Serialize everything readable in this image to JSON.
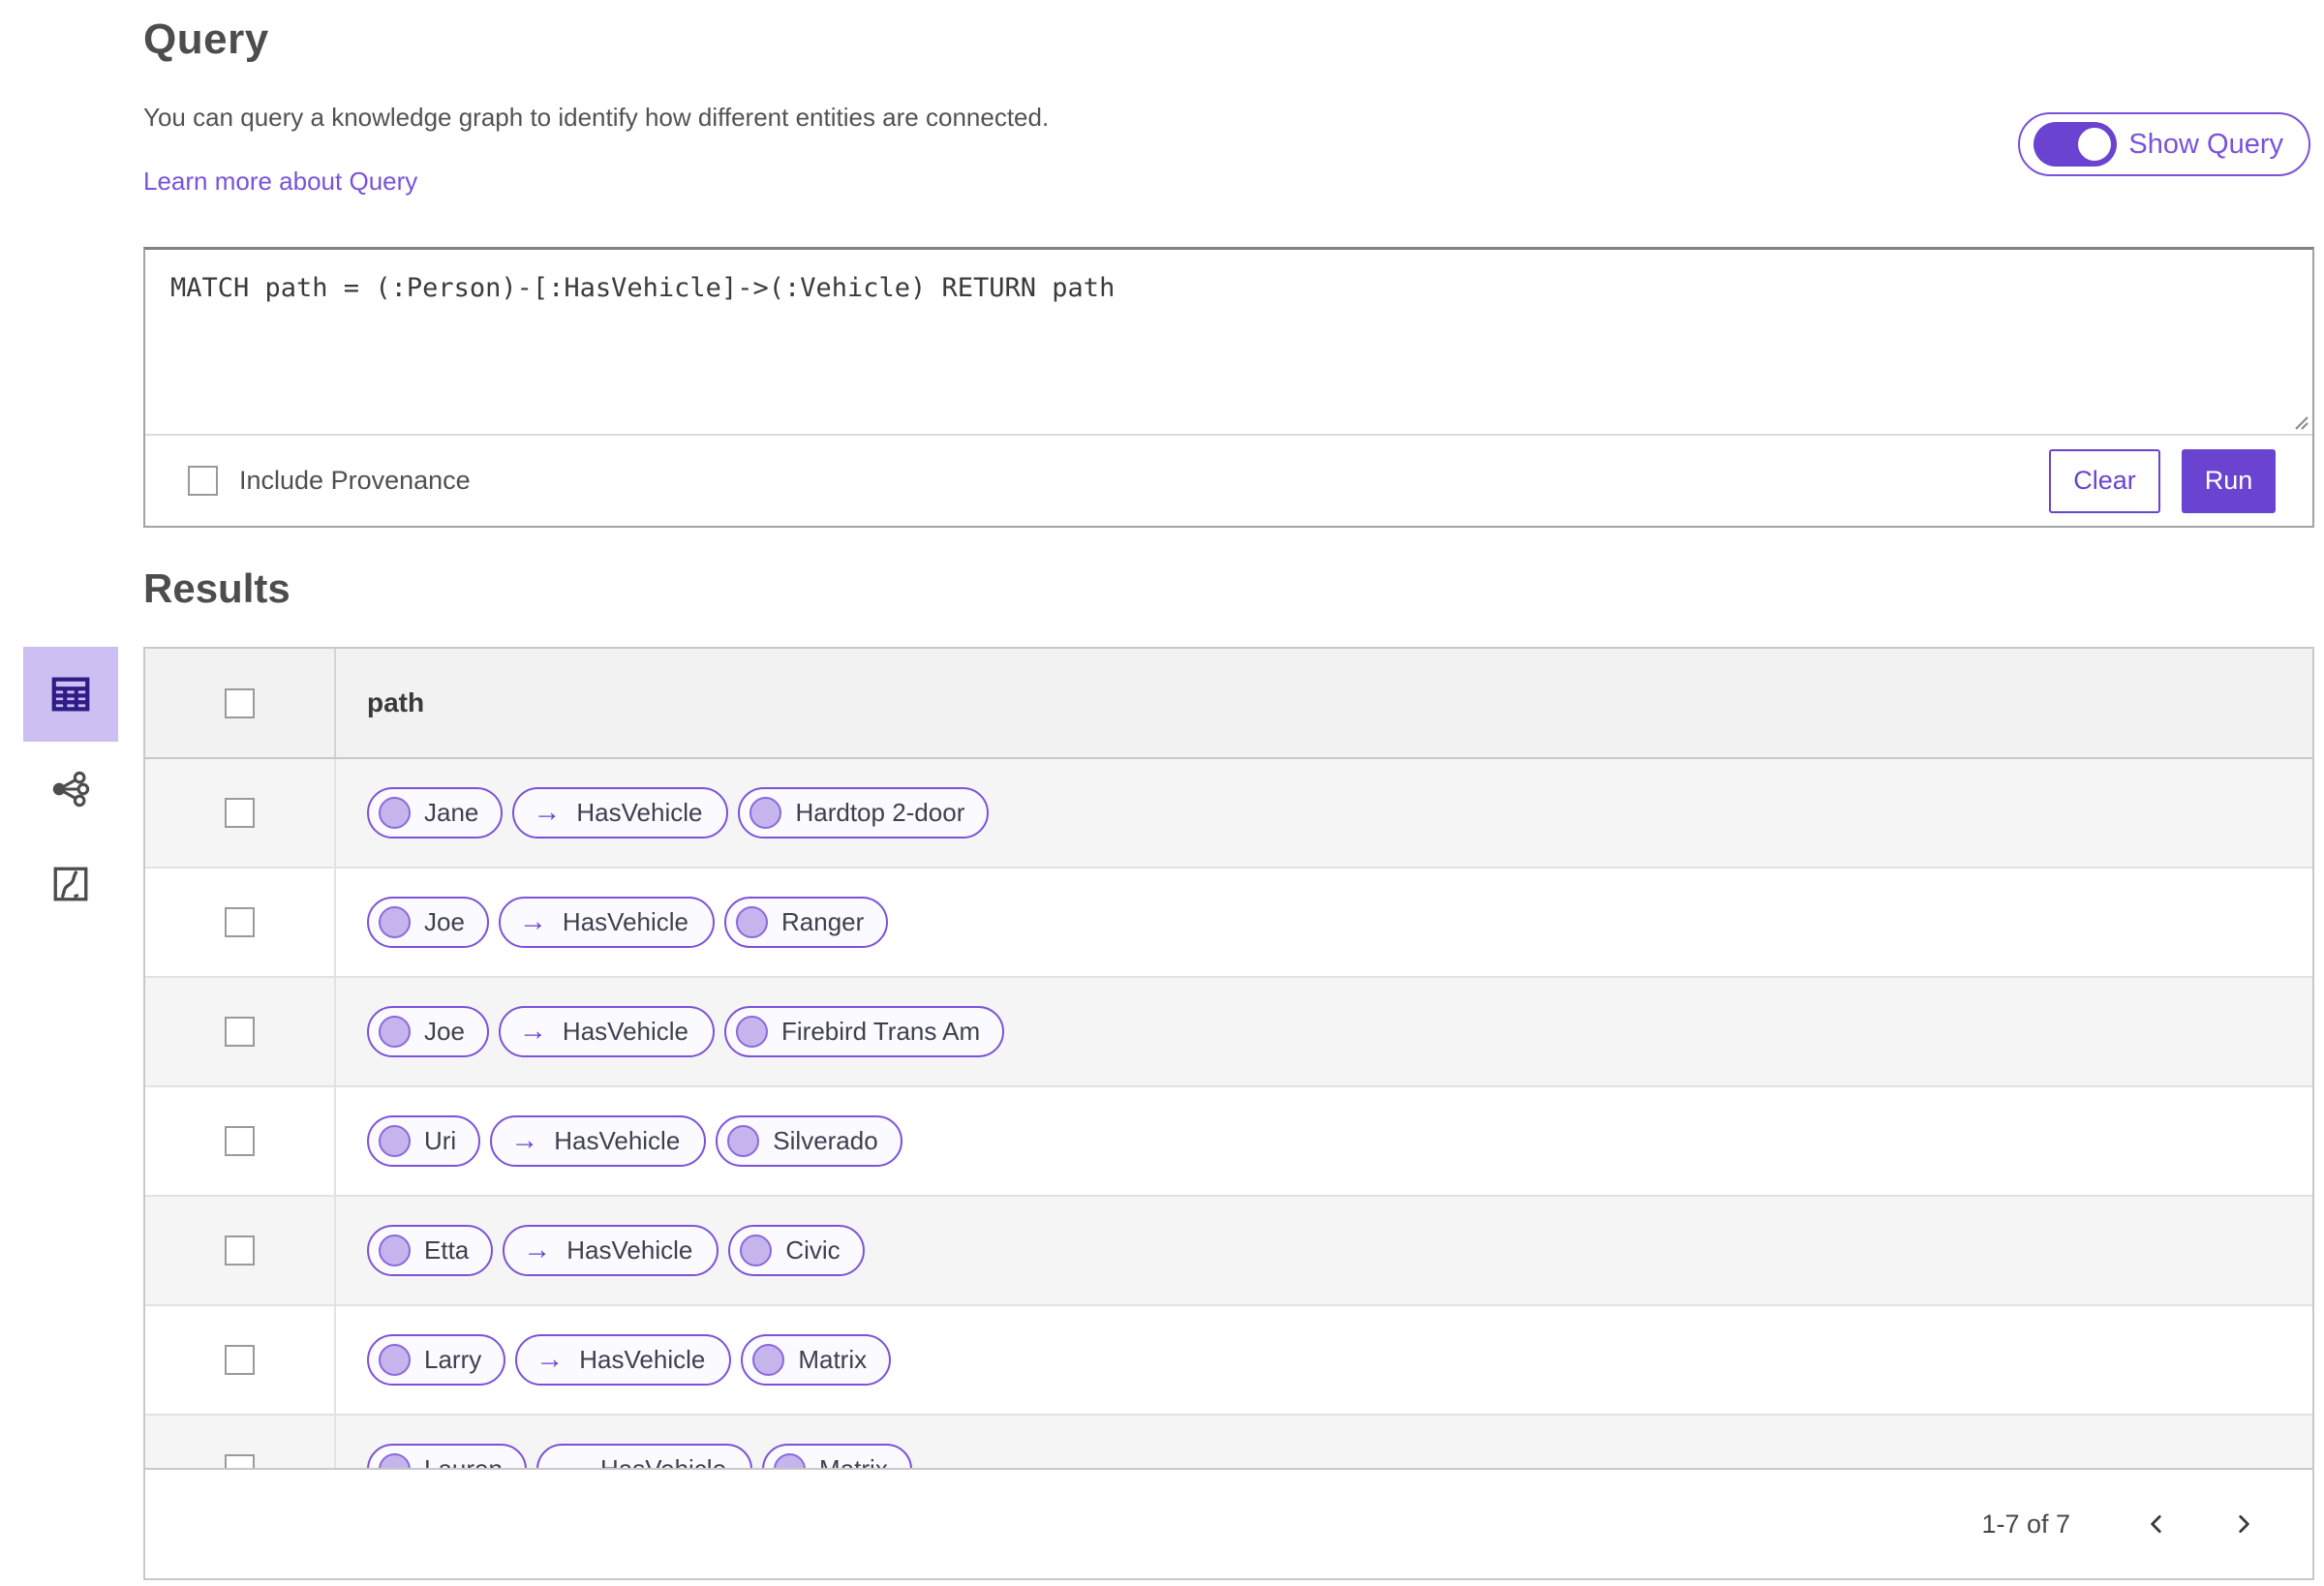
{
  "header": {
    "title": "Query",
    "description": "You can query a knowledge graph to identify how different entities are connected.",
    "learn_more_label": "Learn more about Query",
    "show_query_label": "Show Query",
    "show_query_on": true
  },
  "query": {
    "text": "MATCH path = (:Person)-[:HasVehicle]->(:Vehicle) RETURN path",
    "include_provenance_label": "Include Provenance",
    "include_provenance_checked": false,
    "clear_label": "Clear",
    "run_label": "Run"
  },
  "results": {
    "title": "Results",
    "column_header": "path",
    "edge_arrow": "→",
    "views": [
      {
        "icon": "table-grid-icon",
        "selected": true
      },
      {
        "icon": "network-graph-icon",
        "selected": false
      },
      {
        "icon": "map-route-icon",
        "selected": false
      }
    ],
    "rows": [
      {
        "source": "Jane",
        "relation": "HasVehicle",
        "target": "Hardtop 2-door"
      },
      {
        "source": "Joe",
        "relation": "HasVehicle",
        "target": "Ranger"
      },
      {
        "source": "Joe",
        "relation": "HasVehicle",
        "target": "Firebird Trans Am"
      },
      {
        "source": "Uri",
        "relation": "HasVehicle",
        "target": "Silverado"
      },
      {
        "source": "Etta",
        "relation": "HasVehicle",
        "target": "Civic"
      },
      {
        "source": "Larry",
        "relation": "HasVehicle",
        "target": "Matrix"
      },
      {
        "source": "Lauren",
        "relation": "HasVehicle",
        "target": "Matrix"
      }
    ],
    "pagination": {
      "range_label": "1-7 of 7"
    }
  },
  "colors": {
    "accent": "#6a44d0",
    "link": "#7a52d9",
    "pill-border": "#7c52d8",
    "node-fill": "#c6b5ec",
    "sel-bg": "#cdbff2",
    "icon-dark": "#2e1d86"
  }
}
